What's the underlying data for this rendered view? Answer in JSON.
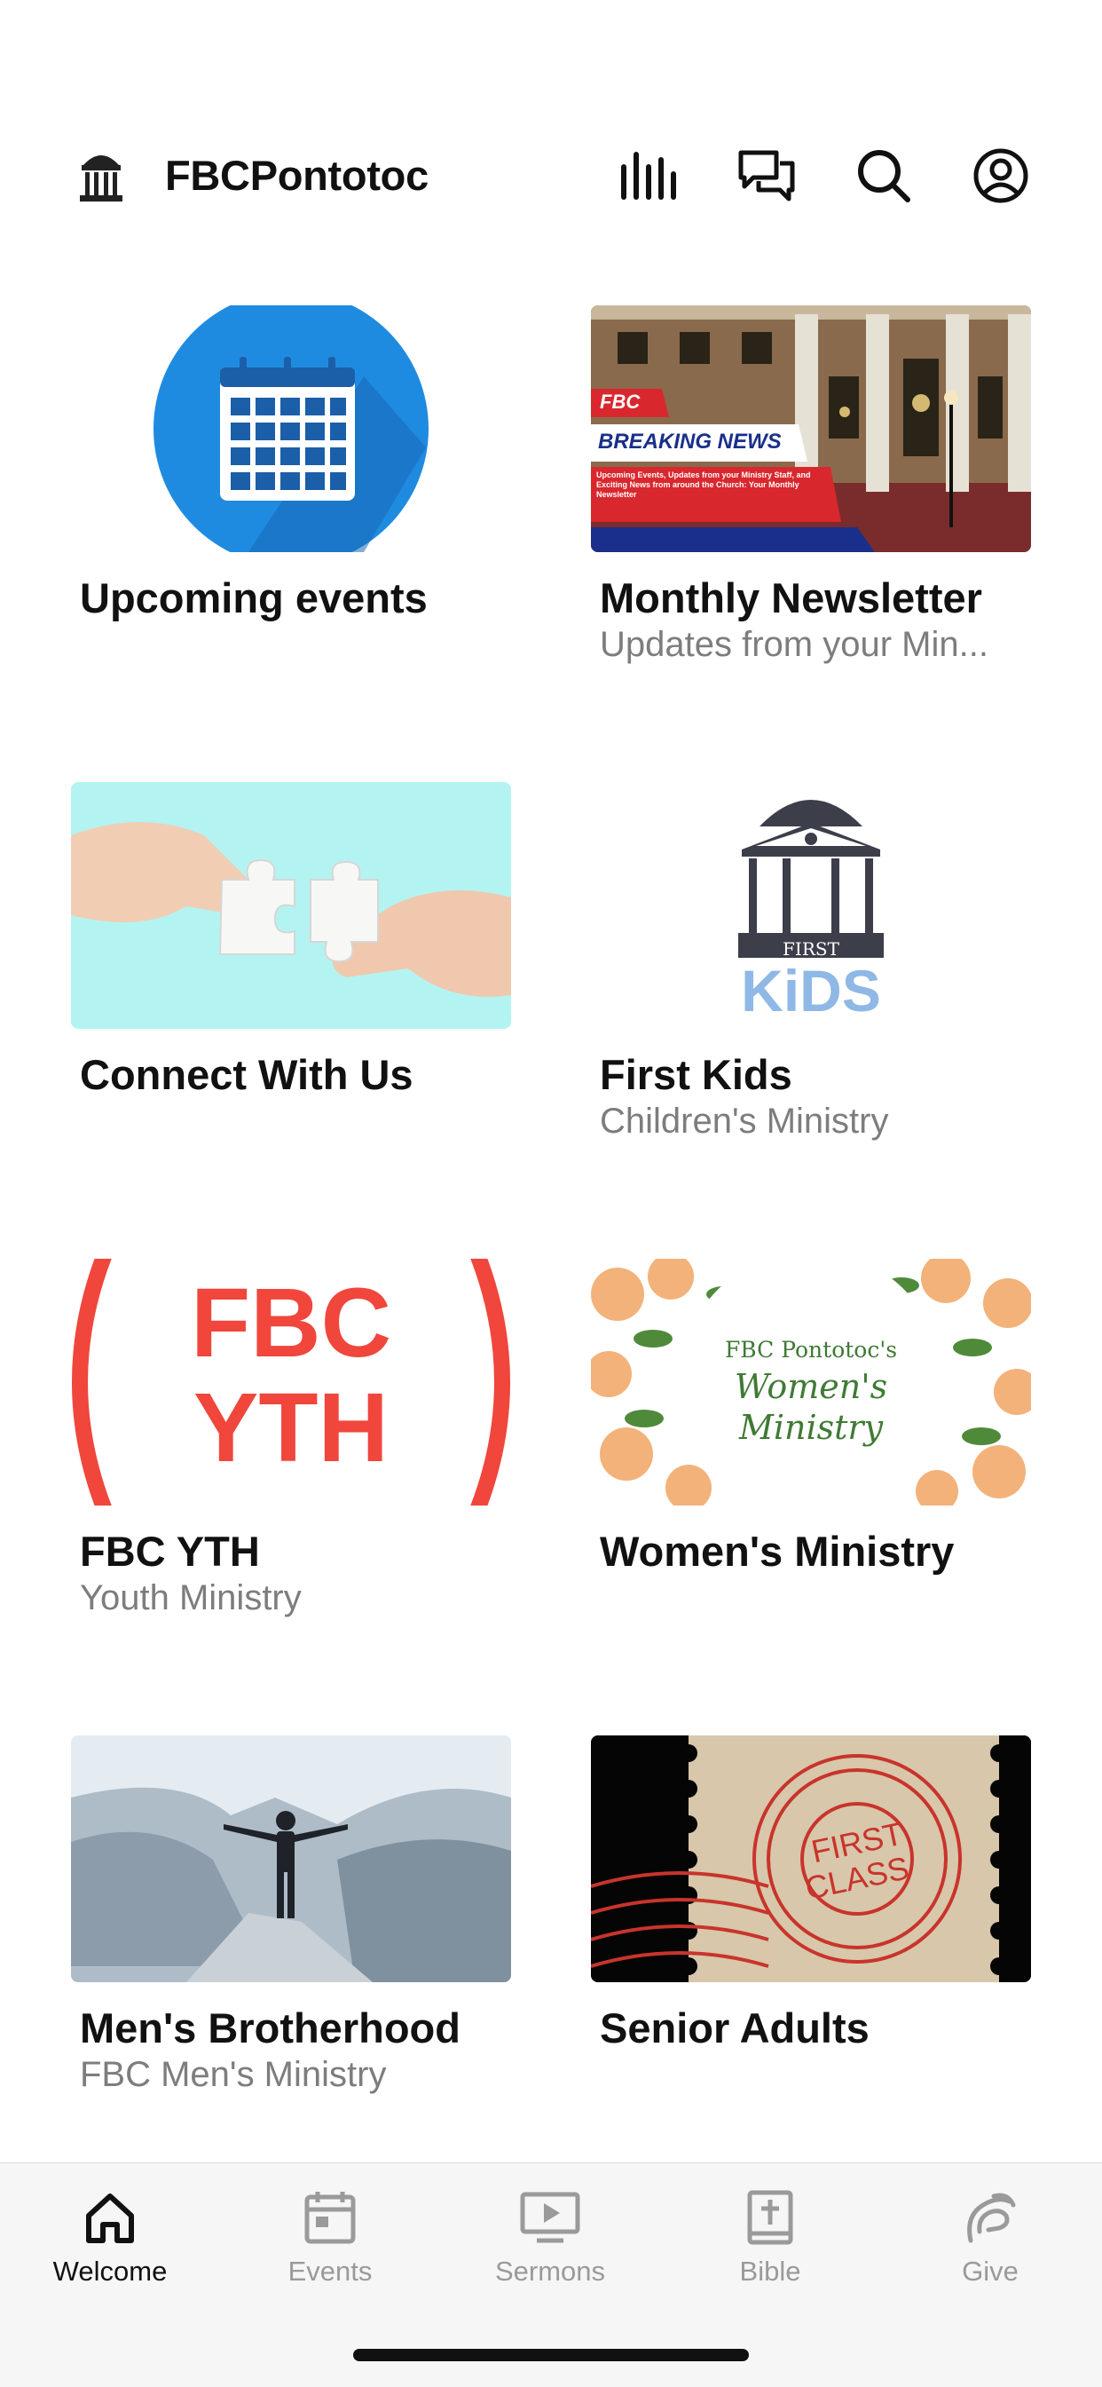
{
  "app": {
    "title": "FBCPontotoc"
  },
  "header": {
    "icons": [
      "audio-bars-icon",
      "chat-bubbles-icon",
      "search-icon",
      "profile-icon"
    ]
  },
  "cards": [
    {
      "title": "Upcoming events",
      "subtitle": "",
      "image": "calendar-icon"
    },
    {
      "title": "Monthly Newsletter",
      "subtitle": "Updates from your Min...",
      "image": "breaking-news-image",
      "banner_tag": "FBC",
      "banner_headline": "BREAKING NEWS",
      "banner_text": "Upcoming Events, Updates from your Ministry Staff, and Exciting News from around the Church: Your Monthly Newsletter"
    },
    {
      "title": "Connect With Us",
      "subtitle": "",
      "image": "puzzle-hands-image"
    },
    {
      "title": "First Kids",
      "subtitle": "Children's Ministry",
      "image": "first-kids-logo",
      "logo_top": "FIRST",
      "logo_bottom": "KiDS"
    },
    {
      "title": "FBC YTH",
      "subtitle": "Youth Ministry",
      "image": "fbc-yth-logo",
      "logo_line1": "FBC",
      "logo_line2": "YTH"
    },
    {
      "title": "Women's Ministry",
      "subtitle": "",
      "image": "womens-ministry-floral",
      "logo_line1": "FBC Pontotoc's",
      "logo_line2": "Women's",
      "logo_line3": "Ministry"
    },
    {
      "title": "Men's Brotherhood",
      "subtitle": "FBC Men's Ministry",
      "image": "mountain-man-image"
    },
    {
      "title": "Senior Adults",
      "subtitle": "",
      "image": "first-class-stamp",
      "stamp_line1": "FIRST",
      "stamp_line2": "CLASS"
    }
  ],
  "tabbar": {
    "tabs": [
      {
        "label": "Welcome",
        "icon": "home-icon",
        "active": true
      },
      {
        "label": "Events",
        "icon": "calendar-icon",
        "active": false
      },
      {
        "label": "Sermons",
        "icon": "play-screen-icon",
        "active": false
      },
      {
        "label": "Bible",
        "icon": "bible-icon",
        "active": false
      },
      {
        "label": "Give",
        "icon": "give-icon",
        "active": false
      }
    ]
  },
  "colors": {
    "accent_blue": "#1f8be0",
    "yth_red": "#f0463c",
    "kids_blue": "#8fb8e6",
    "newsletter_red": "#d9272e",
    "newsletter_navy": "#1a2f8a"
  }
}
